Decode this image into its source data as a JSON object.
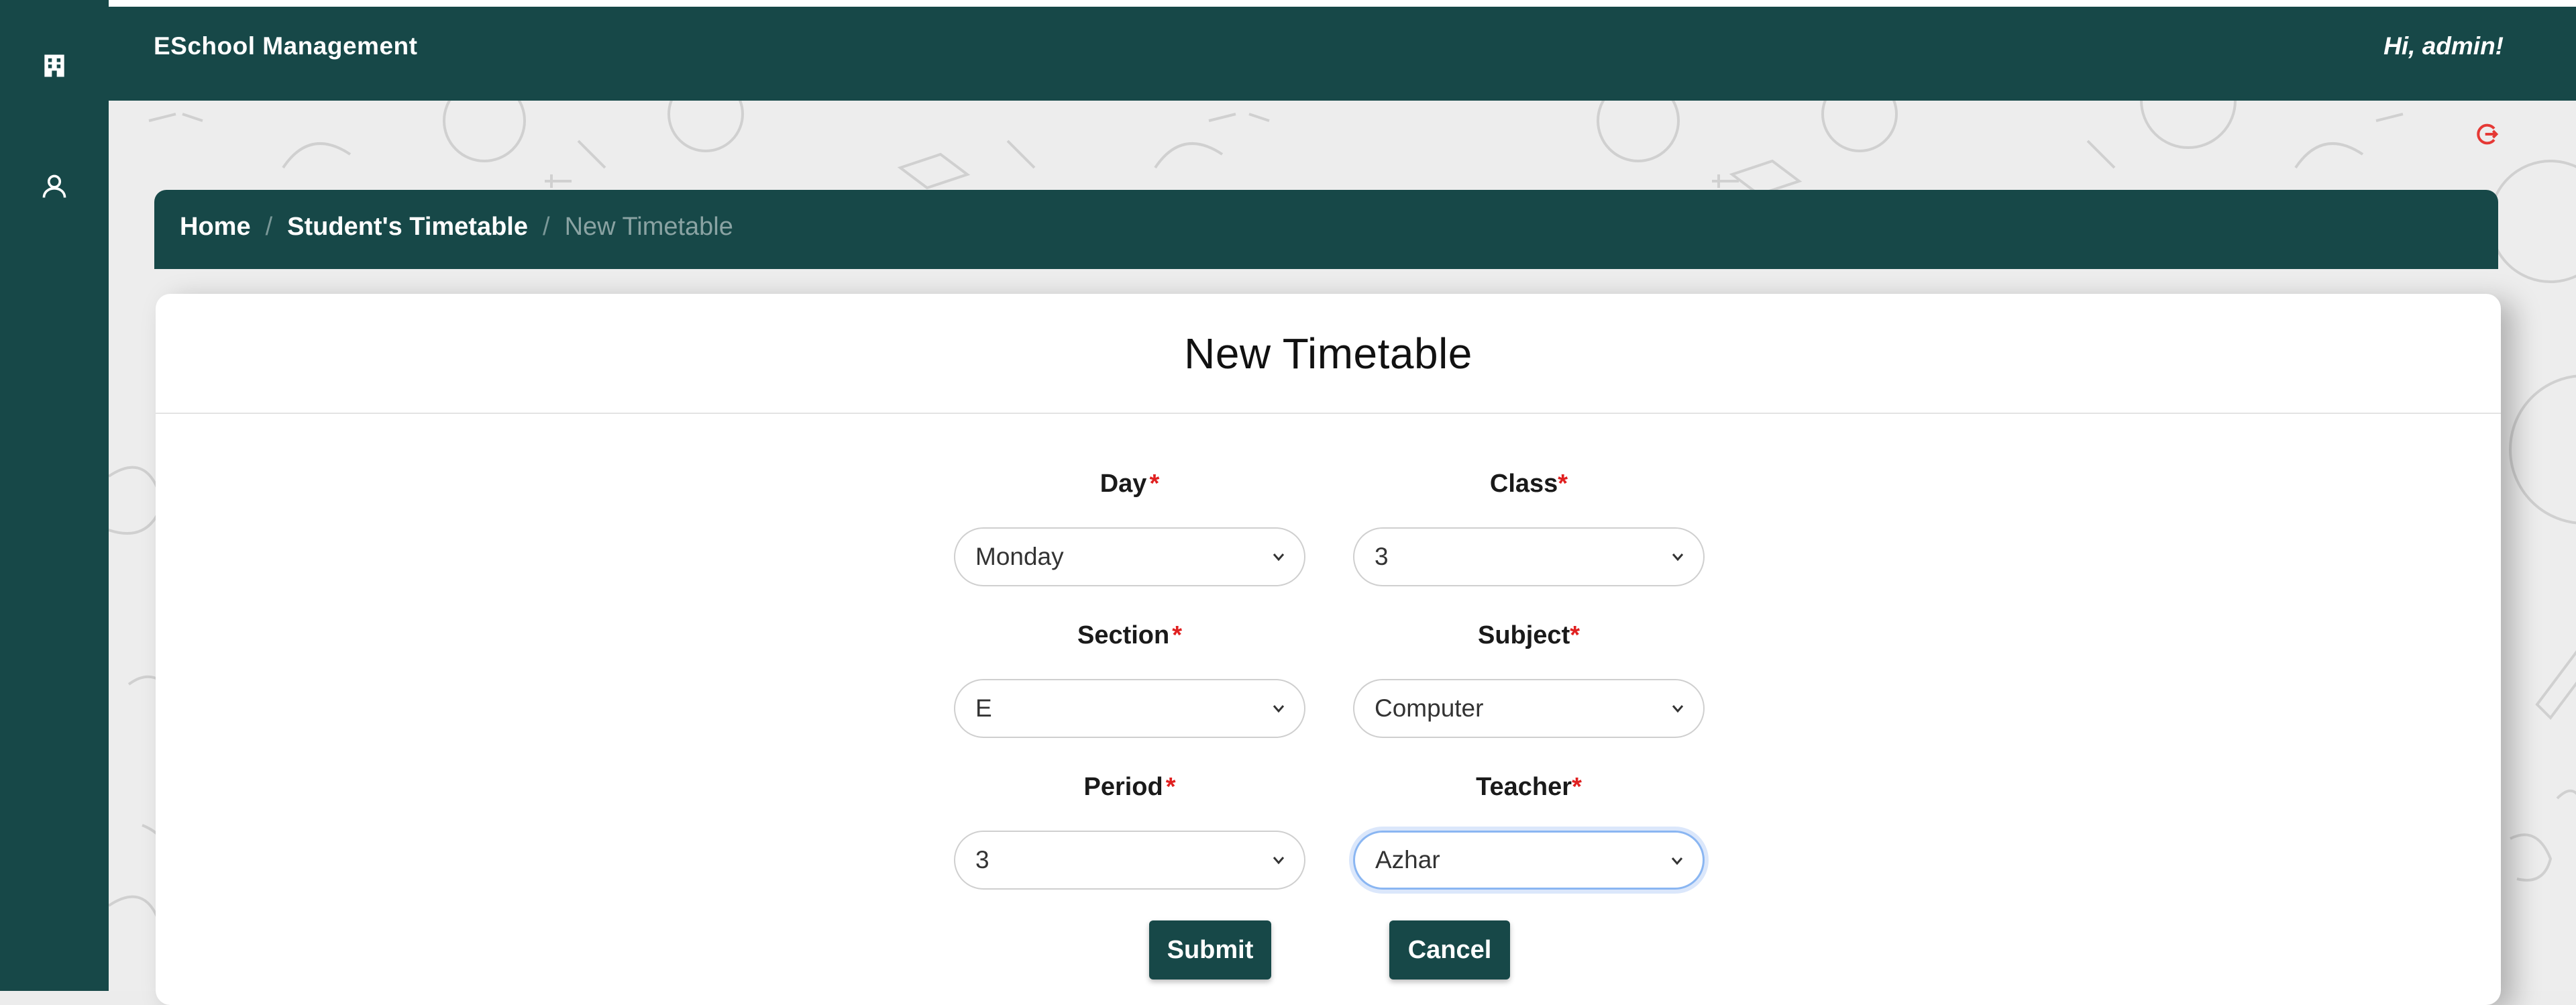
{
  "header": {
    "brand": "ESchool Management",
    "greeting": "Hi, admin!"
  },
  "sidebar": {
    "items": [
      {
        "icon": "building-icon"
      },
      {
        "icon": "user-icon"
      }
    ]
  },
  "breadcrumb": {
    "items": [
      "Home",
      "Student's Timetable"
    ],
    "current": "New Timetable",
    "separator": "/"
  },
  "form": {
    "title": "New Timetable",
    "required_marker": "*",
    "fields": {
      "day": {
        "label": "Day",
        "value": "Monday"
      },
      "class": {
        "label": "Class",
        "value": "3"
      },
      "section": {
        "label": "Section",
        "value": "E"
      },
      "subject": {
        "label": "Subject",
        "value": "Computer"
      },
      "period": {
        "label": "Period",
        "value": "3"
      },
      "teacher": {
        "label": "Teacher",
        "value": "Azhar"
      }
    },
    "submit_label": "Submit",
    "cancel_label": "Cancel"
  },
  "colors": {
    "primary": "#174848",
    "required": "#e02020",
    "focus_ring": "#8ab6f2",
    "logout": "#e53935"
  }
}
